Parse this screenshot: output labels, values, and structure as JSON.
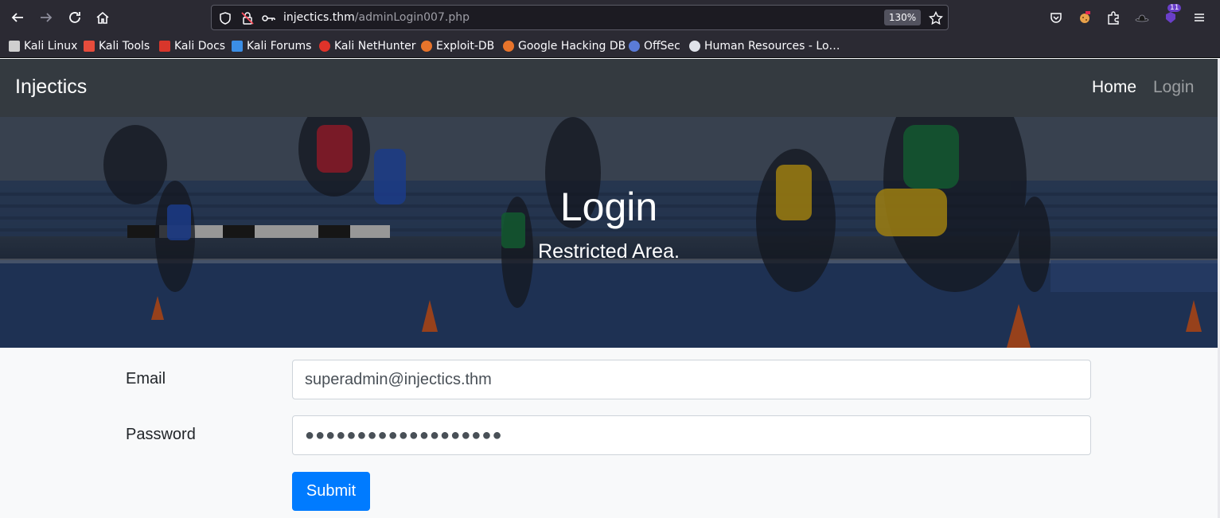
{
  "browser": {
    "url_host": "injectics.thm",
    "url_path": "/adminLogin007.php",
    "zoom": "130%",
    "extensions_badge": "11"
  },
  "bookmarks": [
    {
      "label": "Kali Linux",
      "icon": "kali-dragon-icon",
      "color": "#cfcfcf"
    },
    {
      "label": "Kali Tools",
      "icon": "kali-tools-icon",
      "color": "#e74c3c"
    },
    {
      "label": "Kali Docs",
      "icon": "kali-docs-icon",
      "color": "#d9362b"
    },
    {
      "label": "Kali Forums",
      "icon": "kali-forums-icon",
      "color": "#3b8ee6"
    },
    {
      "label": "Kali NetHunter",
      "icon": "nethunter-icon",
      "color": "#e0332a"
    },
    {
      "label": "Exploit-DB",
      "icon": "exploit-db-icon",
      "color": "#e8742b"
    },
    {
      "label": "Google Hacking DB",
      "icon": "ghdb-icon",
      "color": "#e8742b"
    },
    {
      "label": "OffSec",
      "icon": "offsec-icon",
      "color": "#5a7bd8"
    },
    {
      "label": "Human Resources - Lo…",
      "icon": "wordpress-icon",
      "color": "#dfe3ea"
    }
  ],
  "site": {
    "brand": "Injectics",
    "nav": {
      "home": "Home",
      "login": "Login"
    },
    "hero_title": "Login",
    "hero_subtitle": "Restricted Area.",
    "form": {
      "email_label": "Email",
      "email_value": "superadmin@injectics.thm",
      "password_label": "Password",
      "password_value": "●●●●●●●●●●●●●●●●●●●",
      "submit_label": "Submit"
    }
  },
  "colors": {
    "navbar": "#343a40",
    "primary_button": "#007bff",
    "browser_chrome": "#2b2a33"
  }
}
